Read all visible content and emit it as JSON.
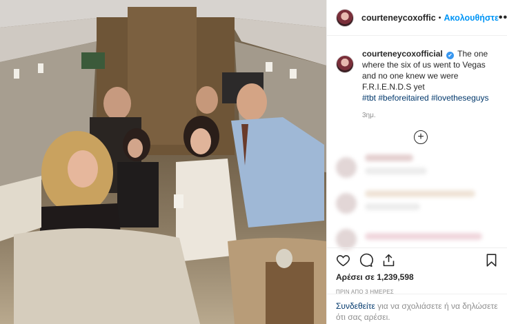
{
  "post": {
    "username": "courteneycoxoffic",
    "follow_label": "Ακολουθήστε",
    "more_label": "•••",
    "dot": "•"
  },
  "caption": {
    "username": "courteneycoxofficial",
    "verified_mark": "✔",
    "text": "The one where the six of us went to Vegas and no one knew we were F.R.I.E.N.D.S yet",
    "hashtags": "#tbt #beforeitaired #lovetheseguys",
    "time": "3ημ."
  },
  "load_more": {
    "label": "+"
  },
  "actions": {
    "like_icon": "heart-icon",
    "comment_icon": "comment-icon",
    "share_icon": "share-icon",
    "save_icon": "bookmark-icon"
  },
  "likes": {
    "text": "Αρέσει σε 1,239,598"
  },
  "posted": {
    "text": "ΠΡΙΝ ΑΠΟ 3 ΗΜΕΡΕΣ"
  },
  "login": {
    "link": "Συνδεθείτε",
    "rest": " για να σχολιάσετε ή να δηλώσετε ότι σας αρέσει."
  },
  "colors": {
    "accent": "#0095f6",
    "verified": "#3897f0",
    "text": "#262626",
    "muted": "#8e8e8e",
    "hashtag": "#00376b"
  }
}
